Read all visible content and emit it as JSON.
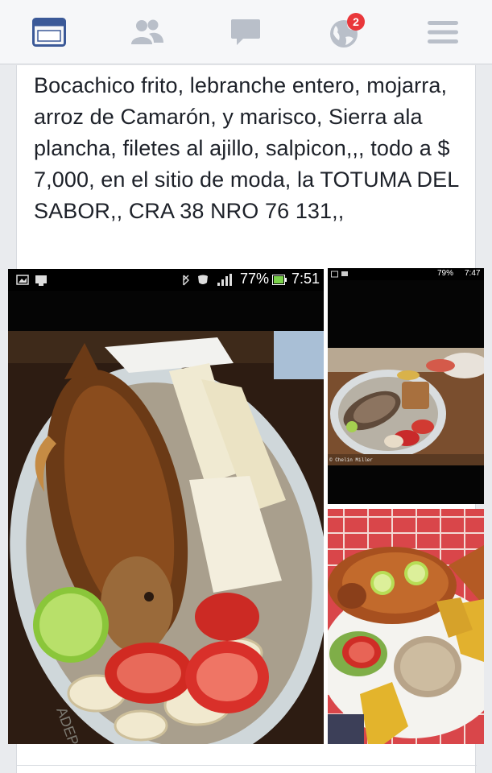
{
  "nav": {
    "notification_count": "2",
    "accent": "#3b5998",
    "icons": [
      "news-feed-icon",
      "friends-icon",
      "messages-icon",
      "notifications-globe-icon",
      "menu-icon"
    ]
  },
  "post": {
    "text": "Bocachico frito, lebranche entero, mojarra, arroz de Camarón, y marisco, Sierra  ala plancha, filetes al ajillo, salpicon,,, todo a $ 7,000, en el sitio de moda, la TOTUMA DEL SABOR,,  CRA 38 NRO 76 131,,"
  },
  "photos": {
    "main": {
      "status_battery": "77%",
      "status_time": "7:51",
      "plate_text": "ADEPESCA"
    },
    "top_right": {
      "status_battery": "79%",
      "status_time": "7:47",
      "watermark": "© Chelin Miller"
    },
    "bottom_right": {}
  }
}
